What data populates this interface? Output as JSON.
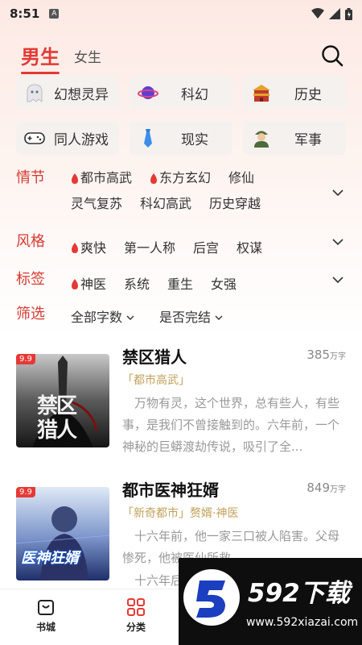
{
  "status": {
    "time": "8:51",
    "app_badge": "A"
  },
  "header": {
    "tab_male": "男生",
    "tab_female": "女生"
  },
  "genres": [
    {
      "label": "幻想灵异",
      "icon": "ghost-icon"
    },
    {
      "label": "科幻",
      "icon": "planet-icon"
    },
    {
      "label": "历史",
      "icon": "palace-icon"
    },
    {
      "label": "同人游戏",
      "icon": "gamepad-icon"
    },
    {
      "label": "现实",
      "icon": "tie-icon"
    },
    {
      "label": "军事",
      "icon": "soldier-icon"
    }
  ],
  "filters": {
    "plot": {
      "title": "情节",
      "items": [
        "都市高武",
        "东方玄幻",
        "修仙",
        "灵气复苏",
        "科幻高武",
        "历史穿越"
      ]
    },
    "style": {
      "title": "风格",
      "items": [
        "爽快",
        "第一人称",
        "后宫",
        "权谋"
      ]
    },
    "tags": {
      "title": "标签",
      "items": [
        "神医",
        "系统",
        "重生",
        "女强"
      ]
    },
    "select": {
      "title": "筛选",
      "items": [
        "全部字数",
        "是否完结"
      ]
    }
  },
  "books": [
    {
      "title": "禁区猎人",
      "count": "385",
      "count_unit": "万字",
      "tag": "「都市高武」",
      "desc": "万物有灵，这个世界，总有些人，有些事，是我们不曾接触到的。六年前，一个神秘的巨蟒渡劫传说，吸引了全...",
      "badge": "9.9",
      "cover_text": "禁区猎人"
    },
    {
      "title": "都市医神狂婿",
      "count": "849",
      "count_unit": "万字",
      "tag_main": "「新奇都市」",
      "tag_extra": "赘婿·神医",
      "desc": "十六年前，他一家三口被人陷害。父母惨死，他被医仙所救...",
      "desc2": "十六年后",
      "badge": "9.9",
      "cover_text": "医神狂婿"
    }
  ],
  "nav": {
    "bookstore": "书城",
    "category": "分类"
  },
  "watermark": {
    "logo_text": "592下载",
    "url": "www.592xiazai.com"
  },
  "colors": {
    "accent": "#e53935",
    "filter_title": "#d63a32",
    "tag": "#c0a15a"
  }
}
